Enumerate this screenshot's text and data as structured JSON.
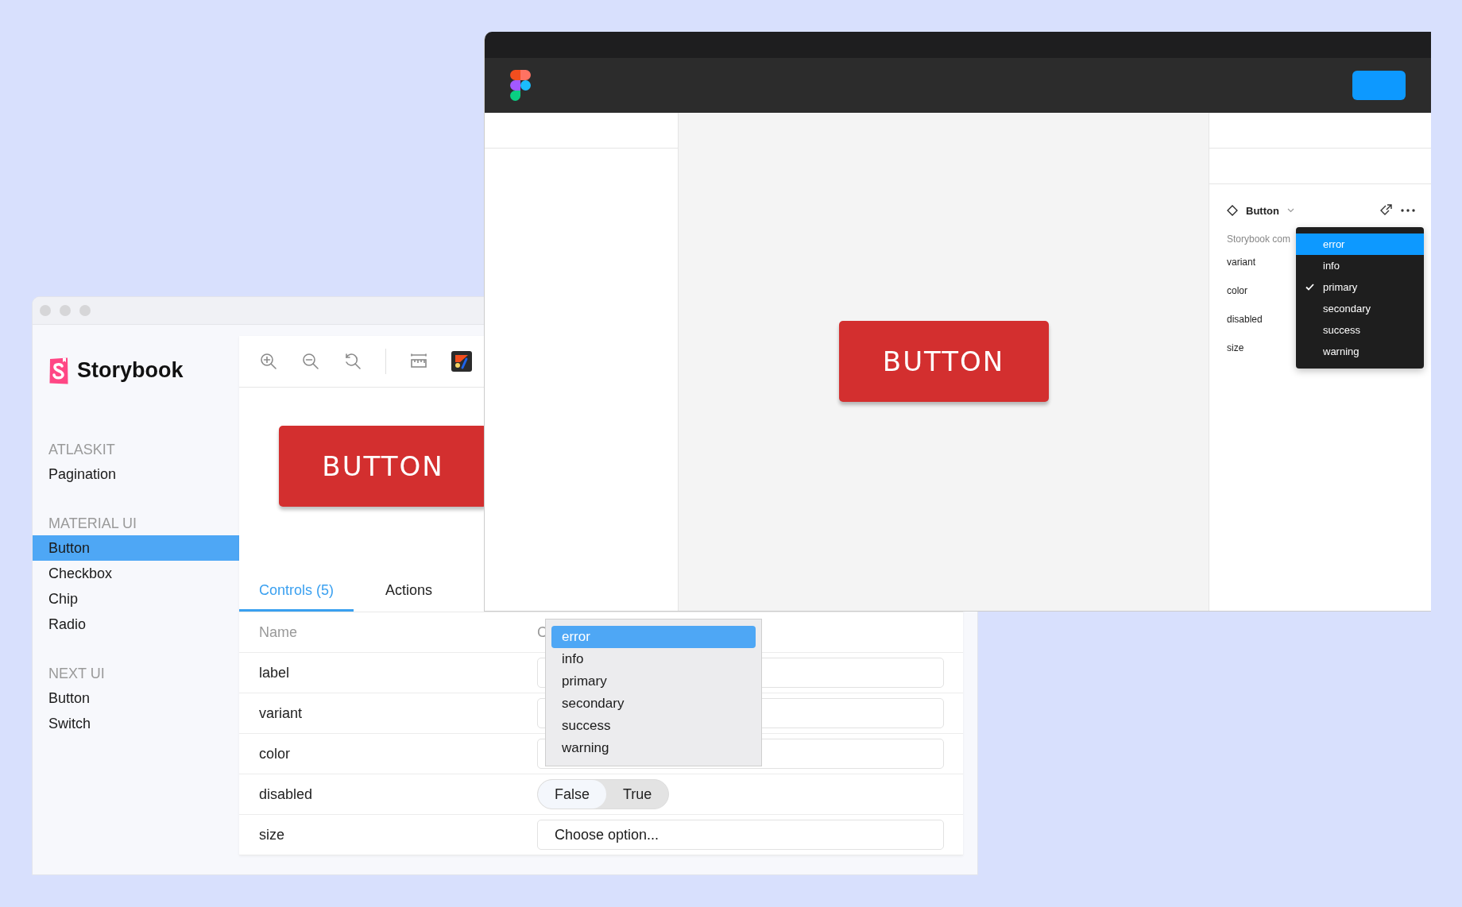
{
  "storybook": {
    "logo": "Storybook",
    "sidebar": [
      {
        "heading": "ATLASKIT",
        "items": [
          {
            "label": "Pagination",
            "selected": false
          }
        ]
      },
      {
        "heading": "MATERIAL UI",
        "items": [
          {
            "label": "Button",
            "selected": true
          },
          {
            "label": "Checkbox",
            "selected": false
          },
          {
            "label": "Chip",
            "selected": false
          },
          {
            "label": "Radio",
            "selected": false
          }
        ]
      },
      {
        "heading": "NEXT UI",
        "items": [
          {
            "label": "Button",
            "selected": false
          },
          {
            "label": "Switch",
            "selected": false
          }
        ]
      }
    ],
    "preview_button": "BUTTON",
    "tabs": [
      {
        "label": "Controls (5)",
        "selected": true
      },
      {
        "label": "Actions",
        "selected": false
      }
    ],
    "table": {
      "columns": [
        "Name",
        "C"
      ],
      "rows": [
        {
          "name": "label",
          "kind": "text"
        },
        {
          "name": "variant",
          "kind": "text"
        },
        {
          "name": "color",
          "kind": "text"
        },
        {
          "name": "disabled",
          "kind": "boolean",
          "options": [
            {
              "label": "False",
              "selected": true
            },
            {
              "label": "True",
              "selected": false
            }
          ]
        },
        {
          "name": "size",
          "kind": "select",
          "placeholder": "Choose option..."
        }
      ]
    },
    "dropdown": [
      {
        "label": "error",
        "highlighted": true
      },
      {
        "label": "info",
        "highlighted": false
      },
      {
        "label": "primary",
        "highlighted": false
      },
      {
        "label": "secondary",
        "highlighted": false
      },
      {
        "label": "success",
        "highlighted": false
      },
      {
        "label": "warning",
        "highlighted": false
      }
    ]
  },
  "figma": {
    "canvas_button": "BUTTON",
    "panel": {
      "title": "Button",
      "description": "Storybook com",
      "properties": [
        "variant",
        "color",
        "disabled",
        "size"
      ]
    },
    "dropdown": [
      {
        "label": "error",
        "highlighted": true,
        "checked": false
      },
      {
        "label": "info",
        "highlighted": false,
        "checked": false
      },
      {
        "label": "primary",
        "highlighted": false,
        "checked": true
      },
      {
        "label": "secondary",
        "highlighted": false,
        "checked": false
      },
      {
        "label": "success",
        "highlighted": false,
        "checked": false
      },
      {
        "label": "warning",
        "highlighted": false,
        "checked": false
      }
    ]
  }
}
